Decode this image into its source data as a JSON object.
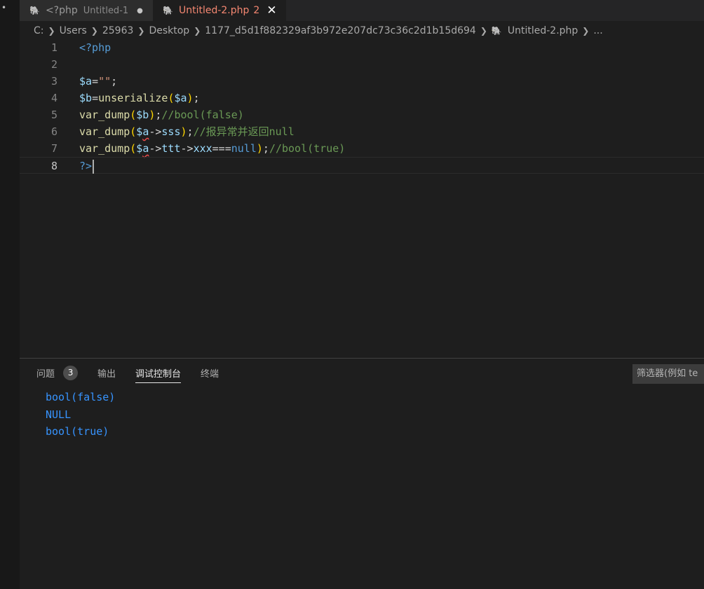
{
  "tabs": [
    {
      "label": "<?php",
      "description": "Untitled-1",
      "modified": true,
      "active": false
    },
    {
      "label": "Untitled-2.php",
      "problems": "2",
      "active": true
    }
  ],
  "breadcrumb": [
    "C:",
    "Users",
    "25963",
    "Desktop",
    "1177_d5d1f882329af3b972e207dc73c36c2d1b15d694",
    "Untitled-2.php",
    "..."
  ],
  "editor": {
    "current_line": 8,
    "lines": [
      {
        "num": "1",
        "text": "<?php"
      },
      {
        "num": "2",
        "text": ""
      },
      {
        "num": "3",
        "text": "$a=\"\";"
      },
      {
        "num": "4",
        "text": "$b=unserialize($a);"
      },
      {
        "num": "5",
        "text": "var_dump($b);//bool(false)"
      },
      {
        "num": "6",
        "text": "var_dump($a->sss);//报异常并返回null"
      },
      {
        "num": "7",
        "text": "var_dump($a->ttt->xxx===null);//bool(true)"
      },
      {
        "num": "8",
        "text": "?>"
      }
    ]
  },
  "panel": {
    "tabs": [
      {
        "label": "问题",
        "count": "3"
      },
      {
        "label": "输出"
      },
      {
        "label": "调试控制台",
        "active": true
      },
      {
        "label": "终端"
      }
    ],
    "filter_placeholder": "筛选器(例如 te",
    "console_output": [
      "bool(false)",
      "NULL",
      "bool(true)"
    ]
  },
  "colors": {
    "background": "#1e1e1e",
    "active_tab_text": "#f48771",
    "console_text": "#3794ff",
    "comment": "#6a9955"
  }
}
